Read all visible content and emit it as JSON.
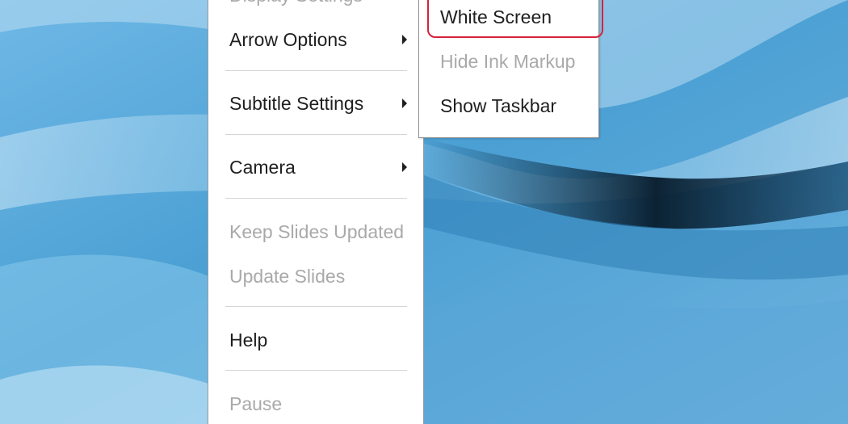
{
  "main_menu": {
    "display_settings": "Display Settings",
    "arrow_options": "Arrow Options",
    "subtitle_settings": "Subtitle Settings",
    "camera": "Camera",
    "keep_slides_updated": "Keep Slides Updated",
    "update_slides": "Update Slides",
    "help": "Help",
    "pause": "Pause"
  },
  "sub_menu": {
    "white_screen": "White Screen",
    "hide_ink_markup": "Hide Ink Markup",
    "show_taskbar": "Show Taskbar"
  },
  "colors": {
    "highlight_border": "#d6223a",
    "disabled_text": "#a9a9a9",
    "text": "#1f1f1f"
  },
  "icons": {
    "submenu_arrow": "caret-right-icon"
  }
}
